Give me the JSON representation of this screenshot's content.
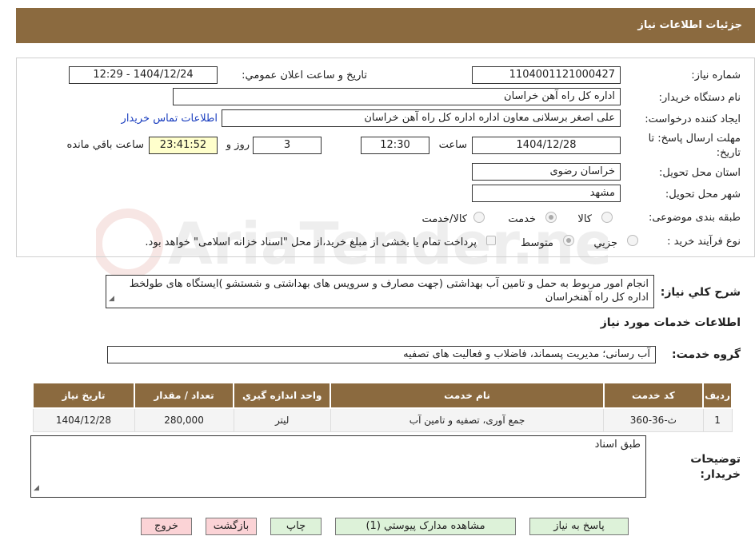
{
  "header": {
    "title": "جزئیات اطلاعات نیاز"
  },
  "form": {
    "need_number_label": "شماره نیاز:",
    "need_number": "1104001121000427",
    "announce_label": "تاريخ و ساعت اعلان عمومي:",
    "announce_value": "1404/12/24 - 12:29",
    "buyer_org_label": "نام دستگاه خريدار:",
    "buyer_org": "اداره کل راه آهن خراسان",
    "requester_label": "ايجاد کننده درخواست:",
    "requester": "علی اصغر برسلانی معاون اداره اداره کل راه آهن خراسان",
    "contact_link": "اطلاعات تماس خريدار",
    "deadline_label_1": "مهلت ارسال پاسخ: تا",
    "deadline_label_2": "تاريخ:",
    "deadline_date": "1404/12/28",
    "time_label": "ساعت",
    "deadline_time": "12:30",
    "days_value": "3",
    "days_label": "روز و",
    "remaining_time": "23:41:52",
    "remaining_label": "ساعت باقي مانده",
    "province_label": "استان محل تحويل:",
    "province": "خراسان رضوی",
    "city_label": "شهر محل تحويل:",
    "city": "مشهد",
    "category_label": "طبقه بندی موضوعی:",
    "category_options": [
      "کالا",
      "خدمت",
      "کالا/خدمت"
    ],
    "category_selected": "خدمت",
    "process_label": "نوع فرآيند خريد :",
    "process_options": [
      "جزيي",
      "متوسط"
    ],
    "process_selected": "متوسط",
    "payment_note": "پرداخت تمام یا بخشی از مبلغ خرید،از محل \"اسناد خزانه اسلامی\" خواهد بود."
  },
  "description": {
    "label": "شرح کلي نياز:",
    "text": "انجام امور مربوط به حمل و تامین آب بهداشتی (جهت مصارف و سرویس های بهداشتی و شستشو )ایستگاه های طولخط اداره کل راه آهنخراسان"
  },
  "services": {
    "section_title": "اطلاعات خدمات مورد نياز",
    "group_label": "گروه خدمت:",
    "group_value": "آب رسانی؛ مدیریت پسماند، فاضلاب و فعالیت های تصفیه",
    "columns": [
      "رديف",
      "کد خدمت",
      "نام خدمت",
      "واحد اندازه گيري",
      "تعداد / مقدار",
      "تاريخ نياز"
    ],
    "rows": [
      [
        "1",
        "ث-36-360",
        "جمع آوری، تصفیه و تامین آب",
        "لیتر",
        "280,000",
        "1404/12/28"
      ]
    ]
  },
  "notes": {
    "label_1": "توضيحات",
    "label_2": "خريدار:",
    "text": "طبق اسناد"
  },
  "buttons": {
    "respond": "پاسخ به نياز",
    "attachments": "مشاهده مدارک پيوستي (1)",
    "print": "چاپ",
    "back": "بازگشت",
    "exit": "خروج"
  },
  "colors": {
    "header_bg": "#8b6a3f",
    "link": "#1a3ebf",
    "timer_bg": "#ffffcc",
    "green_button": "#ddf2d9",
    "pink_button": "#fbd3d6"
  },
  "watermark": {
    "text": "AriaTender.neT"
  }
}
